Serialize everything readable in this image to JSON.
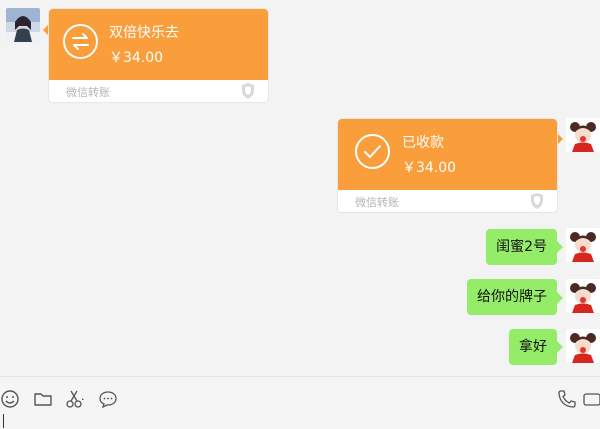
{
  "chat": {
    "transfer_in": {
      "title": "双倍快乐去",
      "amount": "￥34.00",
      "footer": "微信转账",
      "icon": "transfer-arrows-icon"
    },
    "transfer_received": {
      "title": "已收款",
      "amount": "￥34.00",
      "footer": "微信转账",
      "icon": "checkmark-icon"
    },
    "messages": [
      {
        "text": "闺蜜2号"
      },
      {
        "text": "给你的牌子"
      },
      {
        "text": "拿好"
      }
    ]
  },
  "toolbar": {
    "icons": [
      "emoji-icon",
      "folder-icon",
      "scissors-icon",
      "chat-bubble-icon",
      "phone-icon"
    ]
  },
  "colors": {
    "transfer": "#fa9d3b",
    "bubble_self": "#95ec69",
    "background": "#f3f3f3"
  }
}
